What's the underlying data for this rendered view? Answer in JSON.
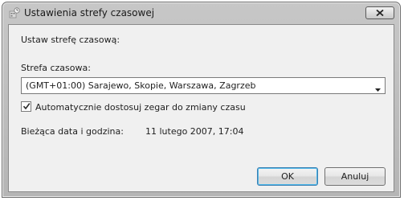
{
  "window": {
    "title": "Ustawienia strefy czasowej",
    "app_icon": "clock-settings-icon",
    "close_icon": "close-icon"
  },
  "main": {
    "heading": "Ustaw strefę czasową:",
    "timezone_label": "Strefa czasowa:",
    "timezone_selected": "(GMT+01:00) Sarajewo, Skopie, Warszawa, Zagrzeb",
    "dst_checkbox_label": "Automatycznie dostosuj zegar do zmiany czasu",
    "dst_checked": true,
    "current_datetime_label": "Bieżąca data i godzina:",
    "current_datetime_value": "11 lutego 2007, 17:04"
  },
  "buttons": {
    "ok": "OK",
    "cancel": "Anuluj"
  },
  "colors": {
    "frame": "#bdbdbd",
    "client_bg": "#f0f0f0",
    "default_button_glow": "#4fb7e8"
  }
}
